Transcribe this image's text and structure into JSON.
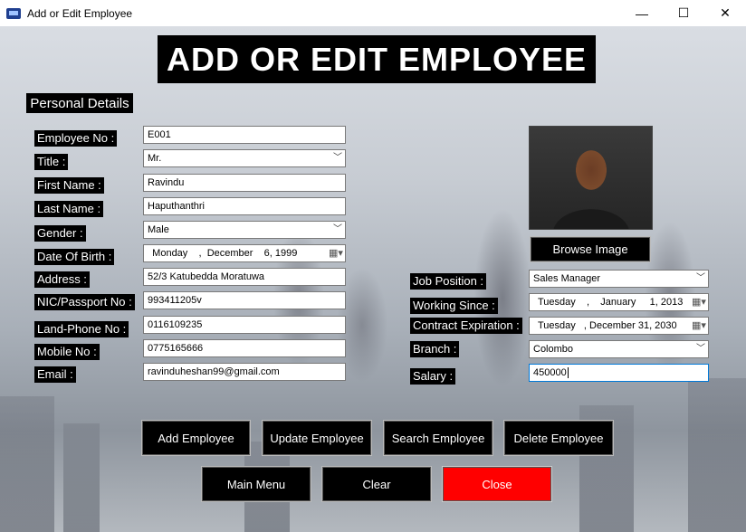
{
  "window": {
    "title": "Add or Edit Employee",
    "minimize": "—",
    "maximize": "☐",
    "close": "✕"
  },
  "heading": "ADD OR EDIT EMPLOYEE",
  "section": "Personal Details",
  "labels": {
    "employee_no": "Employee No :",
    "title": "Title :",
    "first_name": "First Name :",
    "last_name": "Last Name :",
    "gender": "Gender :",
    "dob": "Date Of Birth :",
    "address": "Address :",
    "nic": "NIC/Passport No :",
    "land_phone": "Land-Phone No :",
    "mobile": "Mobile No :",
    "email": "Email :",
    "job_position": "Job Position :",
    "working_since": "Working Since :",
    "contract_expiration": "Contract Expiration :",
    "branch": "Branch :",
    "salary": "Salary :"
  },
  "values": {
    "employee_no": "E001",
    "title": "Mr.",
    "first_name": "Ravindu",
    "last_name": "Haputhanthri",
    "gender": "Male",
    "dob": "   Monday    ,  December    6, 1999",
    "address": "52/3 Katubedda Moratuwa",
    "nic": "993411205v",
    "land_phone": "0116109235",
    "mobile": "0775165666",
    "email": "ravinduheshan99@gmail.com",
    "job_position": "Sales Manager",
    "working_since": "   Tuesday    ,    January     1, 2013",
    "contract_expiration": "   Tuesday   , December 31, 2030",
    "branch": "Colombo",
    "salary": "450000"
  },
  "buttons": {
    "browse": "Browse Image",
    "add": "Add Employee",
    "update": "Update Employee",
    "search": "Search Employee",
    "delete": "Delete Employee",
    "main_menu": "Main Menu",
    "clear": "Clear",
    "close": "Close"
  },
  "colors": {
    "close_button": "#ff0000",
    "label_bg": "#000000"
  },
  "icons": {
    "dropdown": "chevron-down-icon",
    "calendar": "calendar-icon"
  }
}
